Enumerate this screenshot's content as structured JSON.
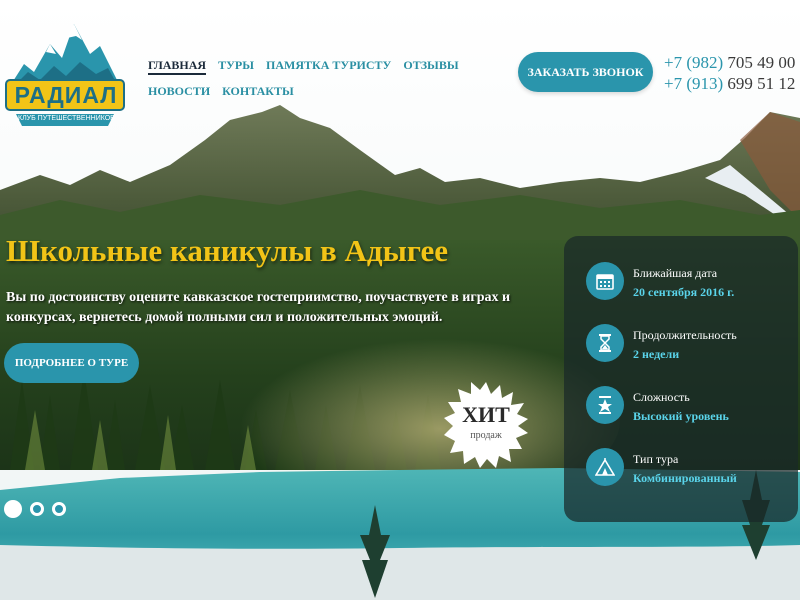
{
  "logo": {
    "name": "РАДИАЛ",
    "tagline": "КЛУБ ПУТЕШЕСТВЕННИКОВ"
  },
  "nav": {
    "items": [
      {
        "label": "ГЛАВНАЯ",
        "active": true
      },
      {
        "label": "ТУРЫ"
      },
      {
        "label": "ПАМЯТКА ТУРИСТУ"
      },
      {
        "label": "ОТЗЫВЫ"
      },
      {
        "label": "НОВОСТИ"
      },
      {
        "label": "КОНТАКТЫ"
      }
    ]
  },
  "header": {
    "call_button": "ЗАКАЗАТЬ ЗВОНОК",
    "phones": [
      {
        "prefix": "+7 (982)",
        "number": " 705 49 00"
      },
      {
        "prefix": "+7 (913)",
        "number": " 699 51 12"
      }
    ]
  },
  "hero": {
    "title": "Школьные каникулы в Адыгее",
    "text": "Вы по достоинству оцените кавказское гостеприимство, поучаствуете в играх и конкурсах, вернетесь домой полными сил и положительных эмоций.",
    "button": "ПОДРОБНЕЕ О ТУРЕ",
    "badge_title": "ХИТ",
    "badge_sub": "продаж",
    "slides": 3,
    "active_slide": 1
  },
  "info": [
    {
      "icon": "calendar-icon",
      "label": "Ближайшая дата",
      "value": "20 сентября 2016 г."
    },
    {
      "icon": "hourglass-icon",
      "label": "Продолжительность",
      "value": "2 недели"
    },
    {
      "icon": "star-hourglass-icon",
      "label": "Сложность",
      "value": "Высокий уровень"
    },
    {
      "icon": "tent-icon",
      "label": "Тип тура",
      "value": "Комбинированный"
    }
  ],
  "colors": {
    "accent": "#2a95ac",
    "title": "#f2c417",
    "value": "#5ad4ea"
  }
}
